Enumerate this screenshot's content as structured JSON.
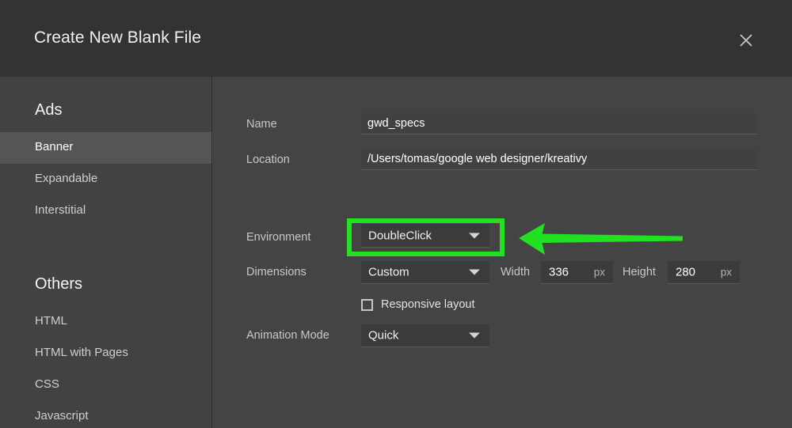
{
  "dialog": {
    "title": "Create New Blank File",
    "close_icon": "close-icon"
  },
  "sidebar": {
    "groups": [
      {
        "title": "Ads",
        "items": [
          {
            "label": "Banner",
            "selected": true
          },
          {
            "label": "Expandable",
            "selected": false
          },
          {
            "label": "Interstitial",
            "selected": false
          }
        ]
      },
      {
        "title": "Others",
        "items": [
          {
            "label": "HTML",
            "selected": false
          },
          {
            "label": "HTML with Pages",
            "selected": false
          },
          {
            "label": "CSS",
            "selected": false
          },
          {
            "label": "Javascript",
            "selected": false
          }
        ]
      }
    ]
  },
  "form": {
    "name": {
      "label": "Name",
      "value": "gwd_specs",
      "placeholder": "Name"
    },
    "location": {
      "label": "Location",
      "value": "/Users/tomas/google web designer/kreativy",
      "placeholder": "Location",
      "browse_icon": "folder-icon"
    },
    "environment": {
      "label": "Environment",
      "value": "DoubleClick"
    },
    "dimensions": {
      "label": "Dimensions",
      "value": "Custom"
    },
    "width": {
      "label": "Width",
      "value": "336",
      "unit": "px"
    },
    "height": {
      "label": "Height",
      "value": "280",
      "unit": "px"
    },
    "responsive": {
      "label": "Responsive layout",
      "checked": false
    },
    "animation_mode": {
      "label": "Animation Mode",
      "value": "Quick"
    }
  },
  "annotation": {
    "color": "#22e022",
    "highlight_target": "environment-select",
    "arrow_direction": "left"
  },
  "colors": {
    "titlebar": "#333333",
    "panel": "#444444",
    "sidebar": "#424242",
    "selected_row": "#555555",
    "field": "#3b3b3b",
    "accent": "#22e022"
  }
}
